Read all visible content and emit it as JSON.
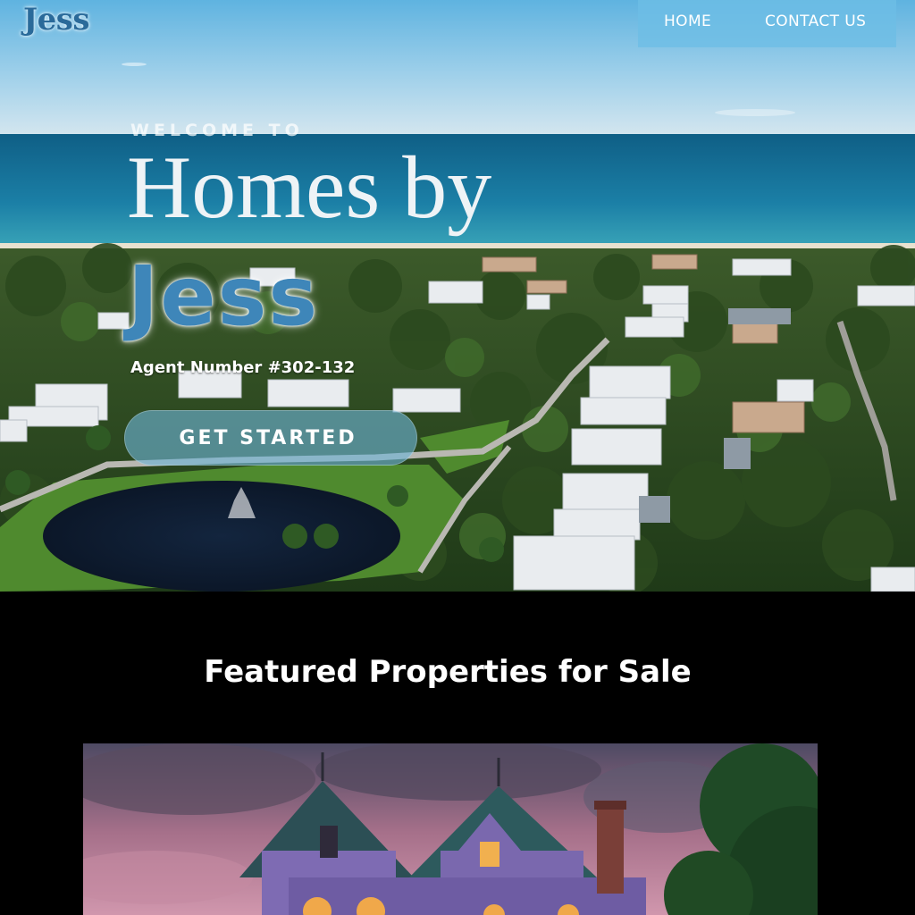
{
  "header": {
    "logo_text": "Jess",
    "nav": {
      "home_label": "HOME",
      "contact_label": "CONTACT US"
    }
  },
  "hero": {
    "welcome_text": "WELCOME TO",
    "headline_line1": "Homes by",
    "headline_line2": "Jess",
    "agent_number": "Agent Number #302-132",
    "cta_label": "GET STARTED"
  },
  "featured": {
    "section_title": "Featured Properties for Sale"
  },
  "colors": {
    "nav_background": "#6dbee6",
    "brand_blue": "#3e86b9",
    "page_background": "#000000"
  }
}
